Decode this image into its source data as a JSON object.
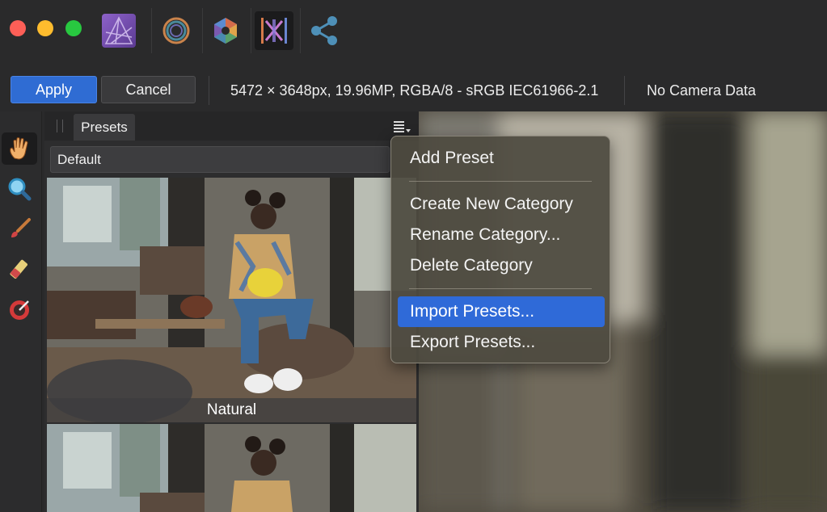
{
  "window": {
    "traffic_lights": {
      "close": "#fe5f57",
      "minimize": "#febc2e",
      "maximize": "#28c840"
    }
  },
  "personas": [
    {
      "name": "photo-persona",
      "icon": "affinity-photo-logo"
    },
    {
      "name": "liquify-persona",
      "icon": "liquify-ring-icon"
    },
    {
      "name": "develop-persona",
      "icon": "develop-aperture-icon"
    },
    {
      "name": "tone-mapping-persona",
      "icon": "tone-mapping-icon",
      "active": true
    },
    {
      "name": "export-persona",
      "icon": "share-icon"
    }
  ],
  "context_toolbar": {
    "apply_label": "Apply",
    "cancel_label": "Cancel",
    "image_info": "5472 × 3648px, 19.96MP, RGBA/8 - sRGB IEC61966-2.1",
    "camera_info": "No Camera Data"
  },
  "tools": [
    {
      "name": "hand-tool",
      "icon": "hand-icon",
      "selected": true
    },
    {
      "name": "zoom-tool",
      "icon": "magnifier-icon"
    },
    {
      "name": "brush-tool",
      "icon": "paint-brush-icon"
    },
    {
      "name": "eraser-tool",
      "icon": "eraser-icon"
    },
    {
      "name": "target-tool",
      "icon": "target-icon"
    }
  ],
  "presets_panel": {
    "tab_label": "Presets",
    "category_value": "Default",
    "presets": [
      {
        "label": "Natural"
      },
      {
        "label": ""
      }
    ]
  },
  "popup_menu": {
    "items": [
      {
        "label": "Add Preset"
      },
      {
        "label": "Create New Category"
      },
      {
        "label": "Rename Category..."
      },
      {
        "label": "Delete Category"
      },
      {
        "label": "Import Presets...",
        "highlighted": true
      },
      {
        "label": "Export Presets..."
      }
    ],
    "highlight_color": "#2f6ad8"
  },
  "colors": {
    "accent": "#2f6cd3",
    "background": "#2a2a2b"
  }
}
